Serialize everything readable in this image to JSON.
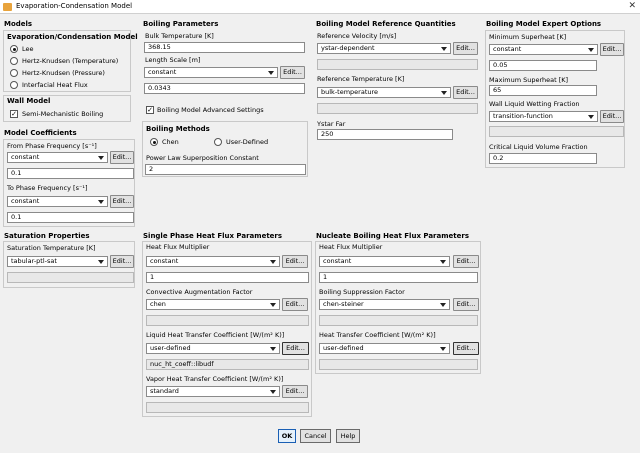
{
  "window": {
    "title": "Evaporation-Condensation Model",
    "close": "✕"
  },
  "models": {
    "heading": "Models",
    "evap_cond": {
      "heading": "Evaporation/Condensation Model",
      "options": [
        "Lee",
        "Hertz-Knudsen (Temperature)",
        "Hertz-Knudsen (Pressure)",
        "Interfacial Heat Flux"
      ],
      "selected": 0
    },
    "wall": {
      "heading": "Wall Model",
      "checkbox": "Semi-Mechanistic Boiling",
      "check": "✓"
    }
  },
  "coefficients": {
    "heading": "Model Coefficients",
    "from_label": "From Phase Frequency [s⁻¹]",
    "from_method": "constant",
    "from_value": "0.1",
    "to_label": "To Phase Frequency [s⁻¹]",
    "to_method": "constant",
    "to_value": "0.1"
  },
  "saturation": {
    "heading": "Saturation Properties",
    "label": "Saturation Temperature [K]",
    "method": "tabular-ptl-sat"
  },
  "boiling_params": {
    "heading": "Boiling Parameters",
    "bulk_label": "Bulk Temperature [K]",
    "bulk_value": "368.15",
    "length_label": "Length Scale [m]",
    "length_method": "constant",
    "length_value": "0.0343",
    "advanced_label": "Boiling Model Advanced Settings",
    "check": "✓"
  },
  "boiling_methods": {
    "heading": "Boiling Methods",
    "options": [
      "Chen",
      "User-Defined"
    ],
    "selected": 0,
    "power_label": "Power Law Superposition Constant",
    "power_value": "2"
  },
  "ref_quantities": {
    "heading": "Boiling Model Reference Quantities",
    "velocity_label": "Reference Velocity [m/s]",
    "velocity_method": "ystar-dependent",
    "temp_label": "Reference Temperature [K]",
    "temp_method": "bulk-temperature",
    "ystar_label": "Ystar Far",
    "ystar_value": "250"
  },
  "expert": {
    "heading": "Boiling Model Expert Options",
    "min_label": "Minimum Superheat [K]",
    "min_method": "constant",
    "min_value": "0.05",
    "max_label": "Maximum Superheat [K]",
    "max_value": "65",
    "wet_label": "Wall Liquid Wetting Fraction",
    "wet_method": "transition-function",
    "crit_label": "Critical Liquid Volume Fraction",
    "crit_value": "0.2"
  },
  "single_phase": {
    "heading": "Single Phase Heat Flux Parameters",
    "mult_label": "Heat Flux Multiplier",
    "mult_method": "constant",
    "mult_value": "1",
    "conv_label": "Convective Augmentation Factor",
    "conv_method": "chen",
    "liq_label": "Liquid Heat Transfer Coefficient [W/(m² K)]",
    "liq_method": "user-defined",
    "liq_udf": "nuc_ht_coeff::libudf",
    "vap_label": "Vapor Heat Transfer Coefficient [W/(m² K)]",
    "vap_method": "standard"
  },
  "nucleate": {
    "heading": "Nucleate Boiling Heat Flux Parameters",
    "mult_label": "Heat Flux Multiplier",
    "mult_method": "constant",
    "mult_value": "1",
    "supp_label": "Boiling Suppression Factor",
    "supp_method": "chen-steiner",
    "htc_label": "Heat Transfer Coefficient [W/(m² K)]",
    "htc_method": "user-defined"
  },
  "edit_label": "Edit...",
  "buttons": {
    "ok": "OK",
    "cancel": "Cancel",
    "help": "Help"
  }
}
